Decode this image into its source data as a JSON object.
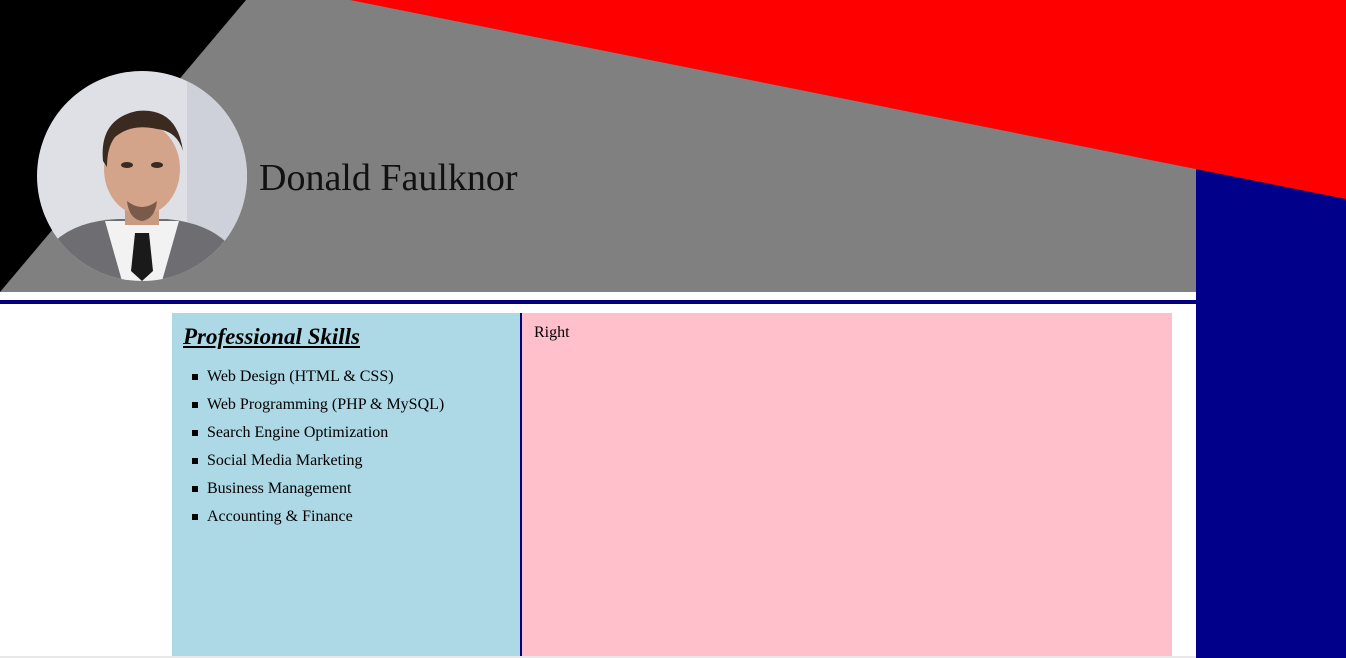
{
  "header": {
    "name": "Donald Faulknor",
    "avatar_icon": "profile-photo",
    "colors": {
      "black_wedge": "#000000",
      "gray_band": "#808080",
      "red_band": "#ff0000",
      "navy": "#00008b",
      "separator": "#000080"
    }
  },
  "skills": {
    "title": "Professional Skills",
    "items": [
      "Web Design (HTML & CSS)",
      "Web Programming (PHP & MySQL)",
      "Search Engine Optimization",
      "Social Media Marketing",
      "Business Management",
      "Accounting & Finance"
    ],
    "background": "#add8e6"
  },
  "right_panel": {
    "text": "Right",
    "background": "#ffc0cb"
  }
}
